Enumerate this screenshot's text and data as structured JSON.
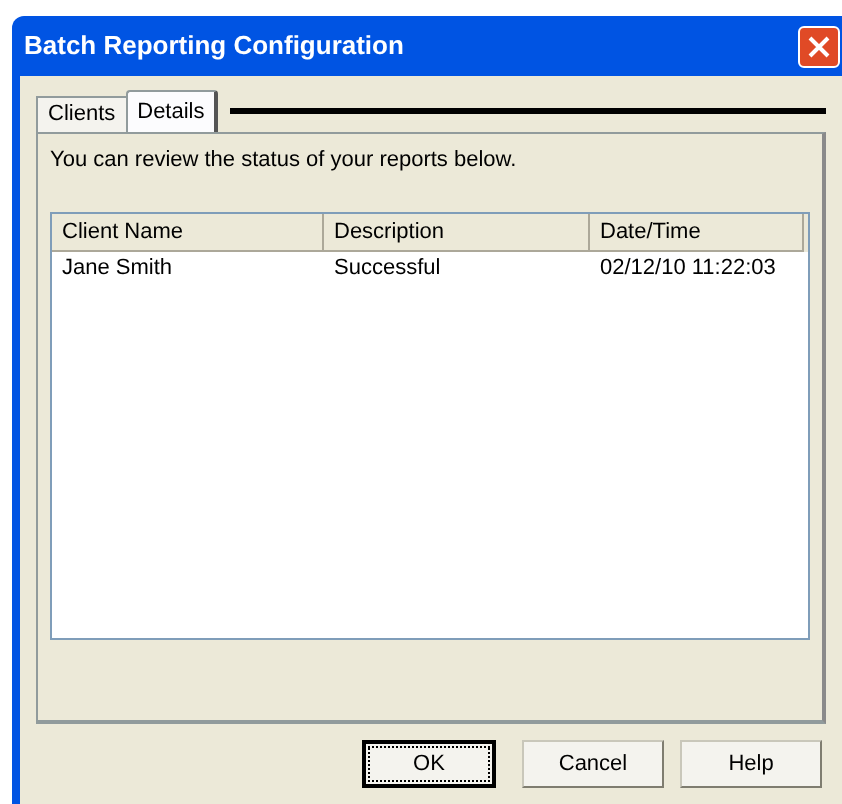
{
  "window": {
    "title": "Batch Reporting Configuration"
  },
  "tabs": [
    {
      "label": "Clients",
      "selected": false
    },
    {
      "label": "Details",
      "selected": true
    }
  ],
  "intro": "You can review the status of your reports below.",
  "table": {
    "columns": [
      "Client Name",
      "Description",
      "Date/Time"
    ],
    "rows": [
      [
        "Jane Smith",
        "Successful",
        "02/12/10 11:22:03"
      ]
    ]
  },
  "buttons": [
    {
      "label": "OK",
      "default": true
    },
    {
      "label": "Cancel",
      "default": false
    },
    {
      "label": "Help",
      "default": false
    }
  ]
}
